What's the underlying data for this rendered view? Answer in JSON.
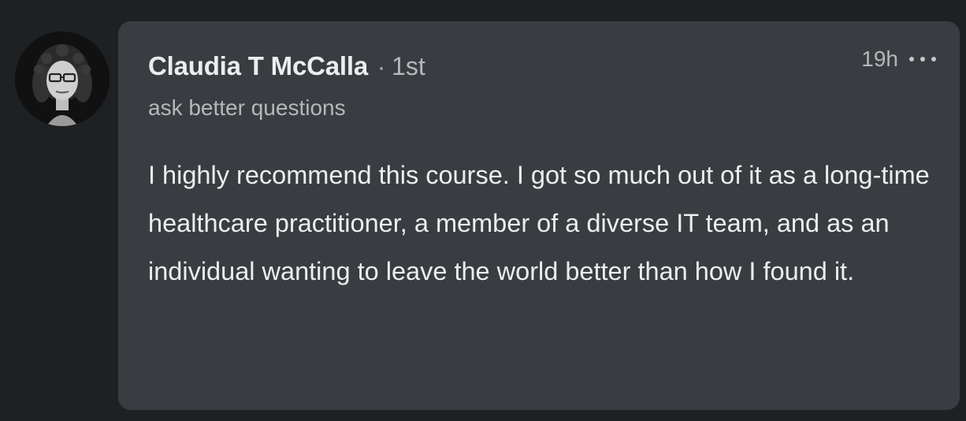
{
  "comment": {
    "author": {
      "name": "Claudia T McCalla",
      "separator": "·",
      "degree": "1st",
      "headline": "ask better questions"
    },
    "timestamp": "19h",
    "menu_icon": "more-horizontal-icon",
    "text": "I highly recommend this course. I got so much out of it as a long-time healthcare practitioner, a member of a diverse IT team, and as an individual wanting to leave the world better than how I found it."
  },
  "colors": {
    "page_background": "#1e2124",
    "bubble_background": "#393d41",
    "primary_text": "#ecedee",
    "secondary_text": "#b5b8bb"
  }
}
